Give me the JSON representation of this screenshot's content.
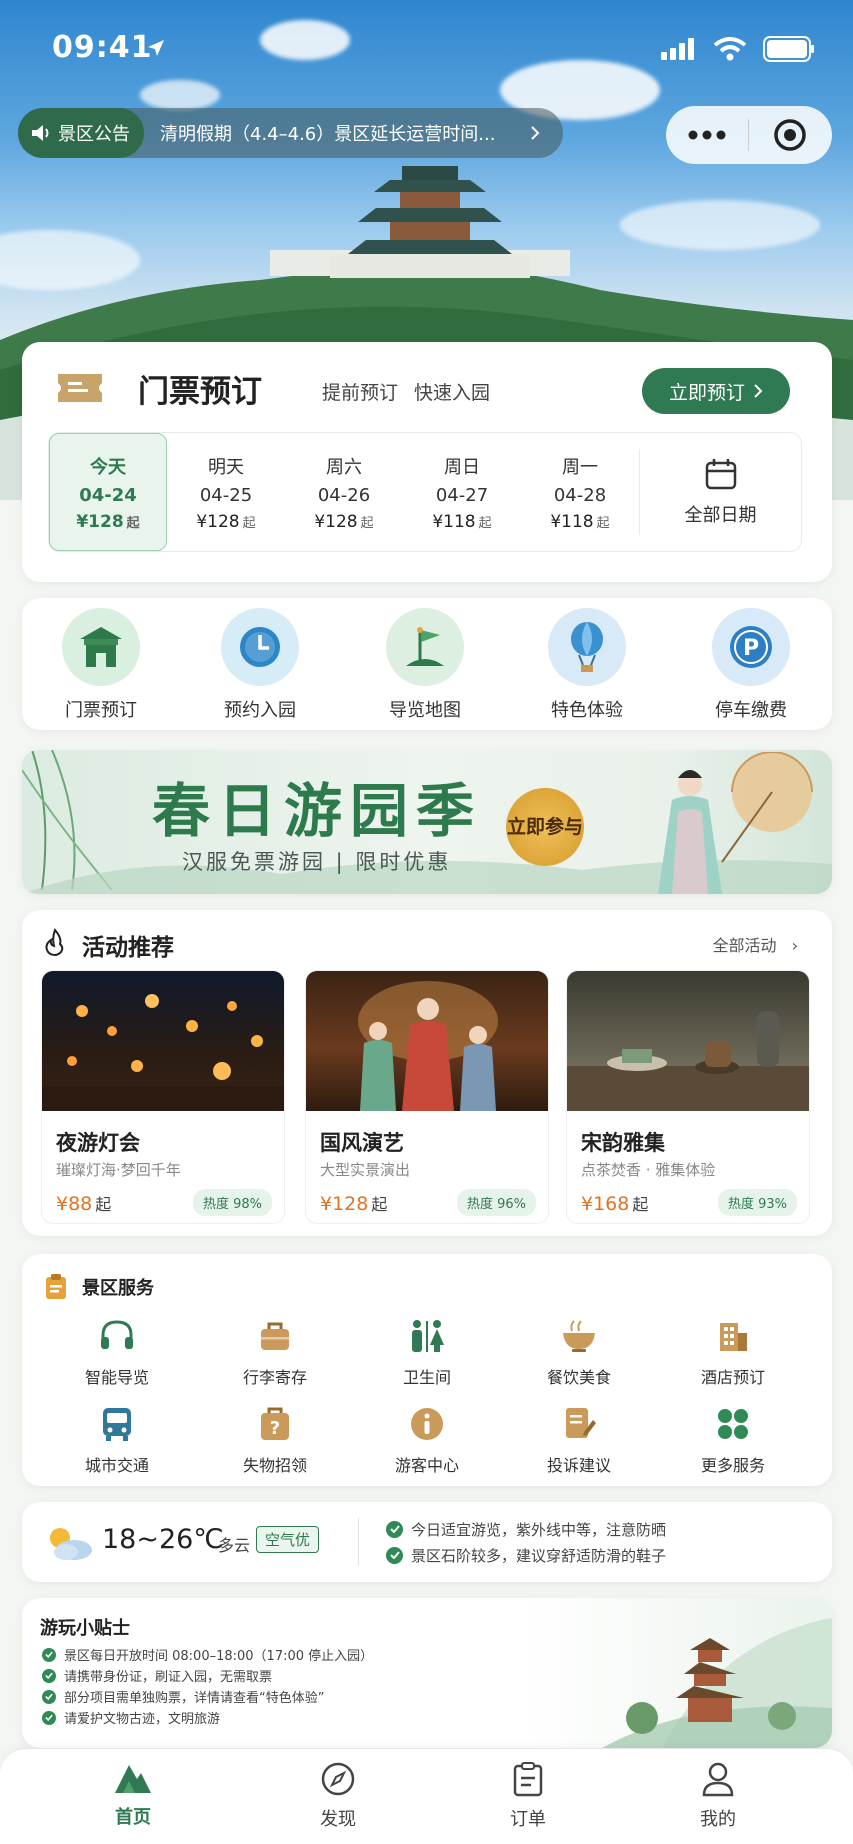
{
  "status_bar": {
    "time": "09:41"
  },
  "notice": {
    "tag": "景区公告",
    "text": "清明假期（4.4–4.6）景区延长运营时间..."
  },
  "ticket": {
    "title": "门票预订",
    "subtitle_1": "提前预订",
    "subtitle_2": "快速入园",
    "book_button": "立即预订",
    "dates": [
      {
        "day": "今天",
        "date": "04-24",
        "price": "¥128",
        "unit": "起",
        "selected": true
      },
      {
        "day": "明天",
        "date": "04-25",
        "price": "¥128",
        "unit": "起"
      },
      {
        "day": "周六",
        "date": "04-26",
        "price": "¥128",
        "unit": "起"
      },
      {
        "day": "周日",
        "date": "04-27",
        "price": "¥118",
        "unit": "起"
      },
      {
        "day": "周一",
        "date": "04-28",
        "price": "¥118",
        "unit": "起"
      }
    ],
    "all_dates": "全部日期"
  },
  "quick_entries": [
    {
      "label": "门票预订",
      "icon": "gate-icon"
    },
    {
      "label": "预约入园",
      "icon": "clock-icon"
    },
    {
      "label": "导览地图",
      "icon": "map-flag-icon"
    },
    {
      "label": "特色体验",
      "icon": "balloon-icon"
    },
    {
      "label": "停车缴费",
      "icon": "parking-icon"
    }
  ],
  "banner": {
    "title": "春日游园季",
    "subtitle": "汉服免票游园 | 限时优惠",
    "badge_line1": "立即",
    "badge_line2": "参与"
  },
  "activities": {
    "title": "活动推荐",
    "more": "全部活动",
    "items": [
      {
        "name": "夜游灯会",
        "desc": "璀璨灯海·梦回千年",
        "price": "¥88",
        "unit": "起",
        "heat": "热度 98%"
      },
      {
        "name": "国风演艺",
        "desc": "大型实景演出",
        "price": "¥128",
        "unit": "起",
        "heat": "热度 96%"
      },
      {
        "name": "宋韵雅集",
        "desc": "点茶焚香 · 雅集体验",
        "price": "¥168",
        "unit": "起",
        "heat": "热度 93%"
      }
    ]
  },
  "services": {
    "title": "景区服务",
    "items": [
      {
        "label": "智能导览",
        "icon": "headphones-icon"
      },
      {
        "label": "行李寄存",
        "icon": "luggage-icon"
      },
      {
        "label": "卫生间",
        "icon": "restroom-icon"
      },
      {
        "label": "餐饮美食",
        "icon": "bowl-icon"
      },
      {
        "label": "酒店预订",
        "icon": "hotel-icon"
      },
      {
        "label": "城市交通",
        "icon": "bus-icon"
      },
      {
        "label": "失物招领",
        "icon": "lost-found-icon"
      },
      {
        "label": "游客中心",
        "icon": "info-icon"
      },
      {
        "label": "投诉建议",
        "icon": "feedback-icon"
      },
      {
        "label": "更多服务",
        "icon": "grid-icon"
      }
    ]
  },
  "weather": {
    "temp": "18~26℃",
    "condition": "多云",
    "air": "空气优",
    "tips": [
      "今日适宜游览，紫外线中等，注意防晒",
      "景区石阶较多，建议穿舒适防滑的鞋子"
    ]
  },
  "play_tips": {
    "title": "游玩小贴士",
    "items": [
      "景区每日开放时间 08:00–18:00（17:00 停止入园）",
      "请携带身份证，刷证入园，无需取票",
      "部分项目需单独购票，详情请查看“特色体验”",
      "请爱护文物古迹，文明旅游"
    ]
  },
  "tabbar": [
    {
      "label": "首页",
      "active": true
    },
    {
      "label": "发现"
    },
    {
      "label": "订单"
    },
    {
      "label": "我的"
    }
  ],
  "colors": {
    "brand": "#2f7a52",
    "price": "#e3741f"
  }
}
